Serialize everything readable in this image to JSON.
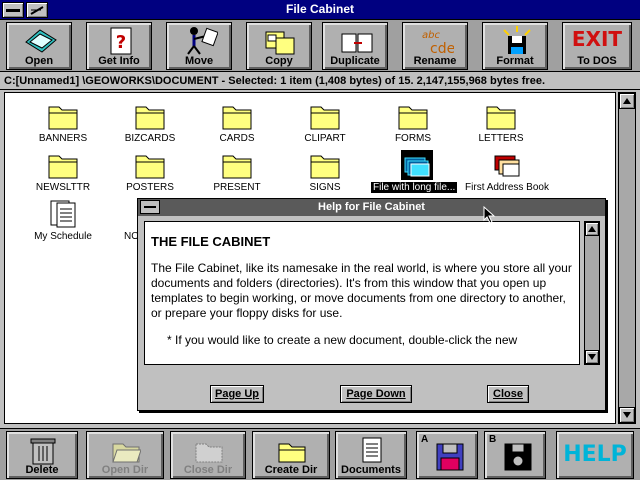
{
  "window": {
    "title": "File Cabinet"
  },
  "toolbar": {
    "items": [
      {
        "label": "Open",
        "icon": "open-icon"
      },
      {
        "label": "Get Info",
        "icon": "get-info-icon"
      },
      {
        "label": "Move",
        "icon": "move-icon"
      },
      {
        "label": "Copy",
        "icon": "copy-icon"
      },
      {
        "label": "Duplicate",
        "icon": "duplicate-icon"
      },
      {
        "label": "Rename",
        "icon": "rename-icon"
      },
      {
        "label": "Format",
        "icon": "format-icon"
      },
      {
        "label": "To DOS",
        "icon": "exit-icon",
        "icon_text": "EXIT"
      }
    ],
    "rename_icon_text": "abc cde"
  },
  "path": {
    "text": "C:[Unnamed1] \\GEOWORKS\\DOCUMENT - Selected: 1 item (1,408 bytes) of 15.  2,147,155,968 bytes free."
  },
  "files": [
    {
      "name": "BANNERS",
      "type": "folder"
    },
    {
      "name": "BIZCARDS",
      "type": "folder"
    },
    {
      "name": "CARDS",
      "type": "folder"
    },
    {
      "name": "CLIPART",
      "type": "folder"
    },
    {
      "name": "FORMS",
      "type": "folder"
    },
    {
      "name": "LETTERS",
      "type": "folder"
    },
    {
      "name": "NEWSLTTR",
      "type": "folder"
    },
    {
      "name": "POSTERS",
      "type": "folder"
    },
    {
      "name": "PRESENT",
      "type": "folder"
    },
    {
      "name": "SIGNS",
      "type": "folder"
    },
    {
      "name": "File with long file...",
      "type": "document-selected"
    },
    {
      "name": "First Address Book",
      "type": "address-book"
    },
    {
      "name": "My Schedule",
      "type": "schedule"
    },
    {
      "name": "NO",
      "type": "document"
    }
  ],
  "help": {
    "title": "Help for File Cabinet",
    "heading": "THE FILE CABINET",
    "paragraph1": "The File Cabinet, like its namesake in the real world, is where you store all your documents and folders (directories). It's from this window that you open up templates to begin working, or move documents from one directory to another, or prepare your floppy disks for use.",
    "paragraph2": "* If you would like to create a new document, double-click the new",
    "buttons": {
      "page_up": "Page Up",
      "page_down": "Page Down",
      "close": "Close"
    }
  },
  "bottombar": {
    "delete": "Delete",
    "open_dir": "Open Dir",
    "close_dir": "Close Dir",
    "create_dir": "Create Dir",
    "documents": "Documents",
    "drive_a": "A",
    "drive_b": "B",
    "help": "HELP"
  },
  "colors": {
    "titlebar": "#000080",
    "help_text": "#00b4d8",
    "exit_red": "#d01010"
  }
}
